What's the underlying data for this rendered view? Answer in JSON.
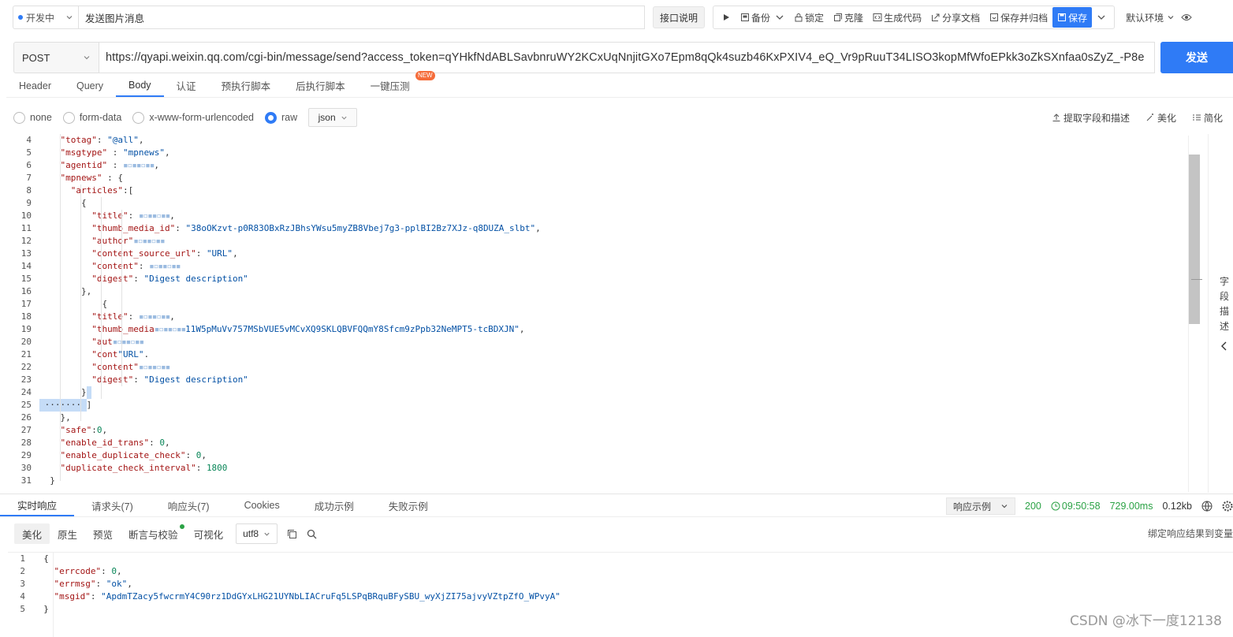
{
  "topbar": {
    "env": "开发中",
    "title_value": "发送图片消息",
    "api_desc": "接口说明",
    "run_tip": "",
    "tools": [
      "备份",
      "锁定",
      "克隆",
      "生成代码",
      "分享文档",
      "保存并归档"
    ],
    "save": "保存",
    "env_default": "默认环境"
  },
  "url_bar": {
    "method": "POST",
    "url": "https://qyapi.weixin.qq.com/cgi-bin/message/send?access_token=qYHkfNdABLSavbnruWY2KCxUqNnjitGXo7Epm8qQk4suzb46KxPXIV4_eQ_Vr9pRuuT34LISO3kopMfWfoEPkk3oZkSXnfaa0sZyZ_-P8e",
    "send": "发送"
  },
  "req_tabs": [
    {
      "label": "Header"
    },
    {
      "label": "Query"
    },
    {
      "label": "Body"
    },
    {
      "label": "认证"
    },
    {
      "label": "预执行脚本"
    },
    {
      "label": "后执行脚本"
    },
    {
      "label": "一键压测"
    }
  ],
  "new_badge": "NEW",
  "body_types": [
    "none",
    "form-data",
    "x-www-form-urlencoded",
    "raw"
  ],
  "body_format": "json",
  "body_tools": [
    "提取字段和描述",
    "美化",
    "简化"
  ],
  "editor": {
    "lines": [
      {
        "n": "4",
        "k": "\"totag\"",
        "sep": ": ",
        "v": "\"@all\"",
        "vt": "str",
        "tail": ","
      },
      {
        "n": "5",
        "k": "\"msgtype\"",
        "sep": " : ",
        "v": "\"mpnews\"",
        "vt": "str",
        "tail": ","
      },
      {
        "n": "6",
        "k": "\"agentid\"",
        "sep": " : ",
        "v": "",
        "vt": "num",
        "tail": ","
      },
      {
        "n": "7",
        "k": "\"mpnews\"",
        "sep": " : ",
        "v": "{",
        "vt": "punc",
        "tail": ""
      },
      {
        "n": "8",
        "k": "\"articles\"",
        "sep": ":",
        "v": "[",
        "vt": "punc",
        "tail": ""
      },
      {
        "n": "9",
        "k": "",
        "sep": "",
        "v": "{",
        "vt": "punc",
        "tail": ""
      },
      {
        "n": "10",
        "k": "\"title\"",
        "sep": ": ",
        "v": "",
        "vt": "str",
        "tail": ","
      },
      {
        "n": "11",
        "k": "\"thumb_media_id\"",
        "sep": ": ",
        "v": "\"38oOKzvt-p0R83OBxRzJBhsYWsu5myZB8Vbej7g3-pplBI2Bz7XJz-q8DUZA_slbt\"",
        "vt": "str",
        "tail": ","
      },
      {
        "n": "12",
        "k": "\"author\"",
        "sep": "",
        "v": "",
        "vt": "str",
        "tail": ""
      },
      {
        "n": "13",
        "k": "\"content_source_url\"",
        "sep": ": ",
        "v": "\"URL\"",
        "vt": "str",
        "tail": ","
      },
      {
        "n": "14",
        "k": "\"content\"",
        "sep": ": ",
        "v": "",
        "vt": "str",
        "tail": ""
      },
      {
        "n": "15",
        "k": "\"digest\"",
        "sep": ": ",
        "v": "\"Digest description\"",
        "vt": "str",
        "tail": ""
      },
      {
        "n": "16",
        "k": "",
        "sep": "",
        "v": "},",
        "vt": "punc",
        "tail": ""
      },
      {
        "n": "17",
        "k": "",
        "sep": "",
        "v": "{",
        "vt": "punc",
        "tail": ""
      },
      {
        "n": "18",
        "k": "\"title\"",
        "sep": ": ",
        "v": "",
        "vt": "str",
        "tail": ","
      },
      {
        "n": "19",
        "k": "\"thumb_media",
        "sep": "",
        "v": "11W5pMuVv757MSbVUE5vMCvXQ9SKLQBVFQQmY8Sfcm9zPpb32NeMPT5-tcBDXJN\"",
        "vt": "str",
        "tail": ","
      },
      {
        "n": "20",
        "k": "\"aut",
        "sep": "",
        "v": "",
        "vt": "str",
        "tail": ""
      },
      {
        "n": "21",
        "k": "\"cont",
        "sep": "",
        "v": "\"URL\"",
        "vt": "str",
        "tail": "."
      },
      {
        "n": "22",
        "k": "\"content\"",
        "sep": "",
        "v": "",
        "vt": "str",
        "tail": ""
      },
      {
        "n": "23",
        "k": "\"digest\"",
        "sep": ": ",
        "v": "\"Digest description\"",
        "vt": "str",
        "tail": ""
      },
      {
        "n": "24",
        "k": "",
        "sep": "",
        "v": "}",
        "vt": "punc",
        "tail": ""
      },
      {
        "n": "25",
        "k": "",
        "sep": "",
        "v": "]",
        "vt": "punc",
        "tail": ""
      },
      {
        "n": "26",
        "k": "",
        "sep": "",
        "v": "},",
        "vt": "punc",
        "tail": ""
      },
      {
        "n": "27",
        "k": "\"safe\"",
        "sep": ":",
        "v": "0",
        "vt": "num",
        "tail": ","
      },
      {
        "n": "28",
        "k": "\"enable_id_trans\"",
        "sep": ": ",
        "v": "0",
        "vt": "num",
        "tail": ","
      },
      {
        "n": "29",
        "k": "\"enable_duplicate_check\"",
        "sep": ": ",
        "v": "0",
        "vt": "num",
        "tail": ","
      },
      {
        "n": "30",
        "k": "\"duplicate_check_interval\"",
        "sep": ": ",
        "v": "1800",
        "vt": "num",
        "tail": ""
      },
      {
        "n": "31",
        "k": "",
        "sep": "",
        "v": "}",
        "vt": "punc",
        "tail": ""
      }
    ]
  },
  "side_panel": "字段描述",
  "resp_tabs": [
    "实时响应",
    "请求头(7)",
    "响应头(7)",
    "Cookies",
    "成功示例",
    "失败示例"
  ],
  "resp_example": "响应示例",
  "status": {
    "code": "200",
    "time": "09:50:58",
    "duration": "729.00ms",
    "size": "0.12kb"
  },
  "resp_tools": [
    "美化",
    "原生",
    "预览",
    "断言与校验",
    "可视化"
  ],
  "resp_encoding": "utf8",
  "bind_text": "绑定响应结果到变量",
  "response": {
    "lines": [
      {
        "n": "1",
        "k": "",
        "sep": "",
        "v": "{",
        "vt": "punc",
        "tail": ""
      },
      {
        "n": "2",
        "k": "\"errcode\"",
        "sep": ": ",
        "v": "0",
        "vt": "num",
        "tail": ","
      },
      {
        "n": "3",
        "k": "\"errmsg\"",
        "sep": ": ",
        "v": "\"ok\"",
        "vt": "str",
        "tail": ","
      },
      {
        "n": "4",
        "k": "\"msgid\"",
        "sep": ": ",
        "v": "\"ApdmTZacy5fwcrmY4C90rz1DdGYxLHG21UYNbLIACruFq5LSPqBRquBFySBU_wyXjZI75ajvyVZtpZfO_WPvyA\"",
        "vt": "str",
        "tail": ""
      },
      {
        "n": "5",
        "k": "",
        "sep": "",
        "v": "}",
        "vt": "punc",
        "tail": ""
      }
    ]
  },
  "watermark": "CSDN @冰下一度12138",
  "colors": {
    "accent": "#2f7bf6",
    "success": "#2ba245",
    "badge": "#f56c3a"
  }
}
